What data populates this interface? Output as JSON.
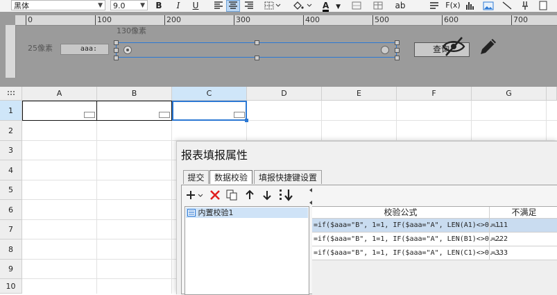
{
  "toolbar": {
    "font": "黑体",
    "font_size": "9.0",
    "bold": "B",
    "italic": "I",
    "underline": "U",
    "text_color_letter": "A",
    "abc_label": "ab",
    "fx_label": "F(x)"
  },
  "design": {
    "ruler_ticks": [
      "0",
      "100",
      "200",
      "300",
      "400",
      "500",
      "600",
      "700"
    ],
    "width_label": "130像素",
    "height_label": "25像素",
    "param_label": "aaa:",
    "query_button": "查询"
  },
  "grid": {
    "columns": [
      "A",
      "B",
      "C",
      "D",
      "E",
      "F",
      "G"
    ],
    "rows": [
      "1",
      "2",
      "3",
      "4",
      "5",
      "6",
      "7",
      "8",
      "9",
      "10"
    ],
    "selected_column": "C"
  },
  "dialog": {
    "title": "报表填报属性",
    "tabs": [
      {
        "label": "提交",
        "active": false
      },
      {
        "label": "数据校验",
        "active": true
      },
      {
        "label": "填报快捷键设置",
        "active": false
      }
    ],
    "list_item": "内置校验1",
    "headers": [
      "校验公式",
      "不满足"
    ],
    "rows": [
      {
        "formula": "=if($aaa=\"B\", 1=1, IF($aaa=\"A\", LEN(A1)<>0...",
        "message": "=111"
      },
      {
        "formula": "=if($aaa=\"B\", 1=1, IF($aaa=\"A\", LEN(B1)<>0...",
        "message": "=222"
      },
      {
        "formula": "=if($aaa=\"B\", 1=1, IF($aaa=\"A\", LEN(C1)<>0...",
        "message": "=333"
      }
    ]
  },
  "colors": {
    "accent": "#2b78d4",
    "delete_red": "#e02020",
    "selected_header": "#cfe6f9"
  }
}
